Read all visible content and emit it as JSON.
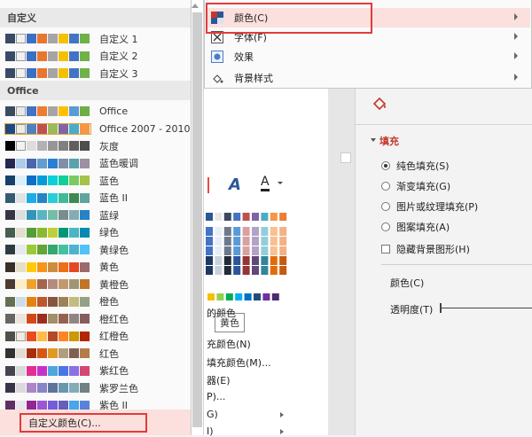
{
  "dropdown": {
    "custom_group": "自定义",
    "office_group": "Office",
    "custom_rows": [
      {
        "label": "自定义 1",
        "colors": [
          "#3a4a66",
          "#f0f0f0",
          "#3b6fc4",
          "#e8762c",
          "#a5a5a5",
          "#f4c000",
          "#4472c4",
          "#6fb24a"
        ]
      },
      {
        "label": "自定义 2",
        "colors": [
          "#3a4a66",
          "#f0f0f0",
          "#3b6fc4",
          "#e8762c",
          "#a5a5a5",
          "#f4c000",
          "#4472c4",
          "#6fb24a"
        ]
      },
      {
        "label": "自定义 3",
        "colors": [
          "#3a4a66",
          "#f0f0f0",
          "#3b6fc4",
          "#e8762c",
          "#a5a5a5",
          "#f4c000",
          "#4472c4",
          "#6fb24a"
        ]
      }
    ],
    "office_rows": [
      {
        "label": "Office",
        "colors": [
          "#3c4a5e",
          "#e8e8e8",
          "#4472c4",
          "#ed7d31",
          "#a5a5a5",
          "#ffc000",
          "#5b9bd5",
          "#70ad47"
        ]
      },
      {
        "label": "Office 2007 - 2010",
        "colors": [
          "#1f497d",
          "#eeece1",
          "#4f81bd",
          "#c0504d",
          "#9bbb59",
          "#8064a2",
          "#4bacc6",
          "#f79646"
        ]
      },
      {
        "label": "灰度",
        "colors": [
          "#000000",
          "#f2f2f2",
          "#dddddd",
          "#b2b2b2",
          "#969696",
          "#808080",
          "#5f5f5f",
          "#4d4d4d"
        ]
      },
      {
        "label": "蓝色暖调",
        "colors": [
          "#242852",
          "#acccea",
          "#4a66ac",
          "#629dd1",
          "#297fd5",
          "#7f8fa9",
          "#5aa2ae",
          "#9d90a0"
        ]
      },
      {
        "label": "蓝色",
        "colors": [
          "#17406d",
          "#dbeff9",
          "#0f6fc6",
          "#009dd9",
          "#0bd0d9",
          "#10cf9b",
          "#7cca62",
          "#a5c249"
        ]
      },
      {
        "label": "蓝色 II",
        "colors": [
          "#335b74",
          "#dfe3e5",
          "#1cade4",
          "#2683c6",
          "#27ced7",
          "#42ba97",
          "#3e8853",
          "#62a39f"
        ]
      },
      {
        "label": "蓝绿",
        "colors": [
          "#373545",
          "#dedede",
          "#3494ba",
          "#58b6c0",
          "#75bda7",
          "#7a8c8e",
          "#84acb6",
          "#2683c6"
        ]
      },
      {
        "label": "绿色",
        "colors": [
          "#455f51",
          "#e3ded1",
          "#549e39",
          "#8ab833",
          "#c0cf3a",
          "#029676",
          "#4ab5c4",
          "#0989b1"
        ]
      },
      {
        "label": "黄绿色",
        "colors": [
          "#2c3c43",
          "#e5e8ed",
          "#99cb38",
          "#63a537",
          "#37a76f",
          "#44c1a3",
          "#4eb3cf",
          "#51c3f9"
        ]
      },
      {
        "label": "黄色",
        "colors": [
          "#39302a",
          "#e5dec9",
          "#ffca08",
          "#f8931d",
          "#ce8d3e",
          "#ec7016",
          "#e64823",
          "#9c6a6a"
        ]
      },
      {
        "label": "黄橙色",
        "colors": [
          "#4e3b30",
          "#fbeec9",
          "#f0a22e",
          "#a5644e",
          "#b58b80",
          "#c3986d",
          "#a19574",
          "#c17529"
        ]
      },
      {
        "label": "橙色",
        "colors": [
          "#637052",
          "#ccddea",
          "#e48312",
          "#bd582c",
          "#865640",
          "#9b8357",
          "#c2bc80",
          "#94a088"
        ]
      },
      {
        "label": "橙红色",
        "colors": [
          "#696464",
          "#e9e5dc",
          "#d34817",
          "#9b2d1f",
          "#a28e6a",
          "#956251",
          "#918485",
          "#855d5d"
        ]
      },
      {
        "label": "红橙色",
        "colors": [
          "#505046",
          "#eeece1",
          "#e84c22",
          "#ffbd47",
          "#b64926",
          "#ff8427",
          "#cc9900",
          "#b22600"
        ]
      },
      {
        "label": "红色",
        "colors": [
          "#323232",
          "#e3dcd2",
          "#a5300f",
          "#d55816",
          "#e19825",
          "#b19c7d",
          "#7f5f52",
          "#b27d49"
        ]
      },
      {
        "label": "紫红色",
        "colors": [
          "#454551",
          "#d8d9dc",
          "#e32d91",
          "#c830cc",
          "#4ea6dc",
          "#4775e7",
          "#8971e1",
          "#d54773"
        ]
      },
      {
        "label": "紫罗兰色",
        "colors": [
          "#373545",
          "#dcd8dc",
          "#ad84c6",
          "#8784c7",
          "#5d739a",
          "#6997af",
          "#84acb6",
          "#6f8183"
        ]
      },
      {
        "label": "紫色 II",
        "colors": [
          "#632e62",
          "#eae5eb",
          "#92278f",
          "#9b57d3",
          "#755dd9",
          "#665eb8",
          "#45a5ed",
          "#5982db"
        ]
      }
    ],
    "custom_color_button": "自定义颜色(C)..."
  },
  "submenu": {
    "items": [
      {
        "label": "颜色(C)",
        "icon": "color-scheme-icon"
      },
      {
        "label": "字体(F)",
        "icon": "font-icon"
      },
      {
        "label": "效果",
        "icon": "effects-icon"
      },
      {
        "label": "背景样式",
        "icon": "background-style-icon"
      }
    ]
  },
  "background": {
    "tooltip": "黄色",
    "fragments": [
      "的颜色",
      "充颜色(N)",
      "填充颜色(M)...",
      "器(E)",
      "P)...",
      "G)",
      "I)"
    ]
  },
  "format_pane": {
    "section": "填充",
    "options": [
      {
        "label": "纯色填充(S)",
        "type": "radio",
        "checked": true
      },
      {
        "label": "渐变填充(G)",
        "type": "radio",
        "checked": false
      },
      {
        "label": "图片或纹理填充(P)",
        "type": "radio",
        "checked": false
      },
      {
        "label": "图案填充(A)",
        "type": "radio",
        "checked": false
      },
      {
        "label": "隐藏背景图形(H)",
        "type": "checkbox",
        "checked": false
      }
    ],
    "color_label": "颜色(C)",
    "transparency_label": "透明度(T)"
  }
}
